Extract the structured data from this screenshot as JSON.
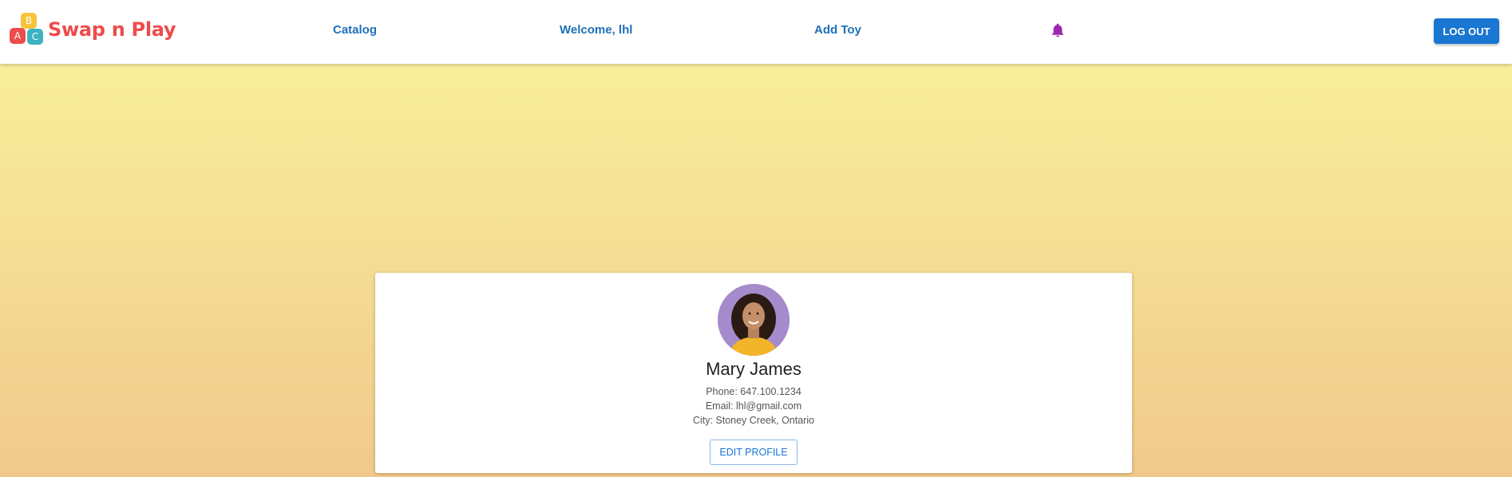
{
  "app": {
    "name": "Swap n Play",
    "logo_letters": [
      "B",
      "A",
      "C"
    ]
  },
  "nav": {
    "catalog": "Catalog",
    "welcome": "Welcome, lhl",
    "add_toy": "Add Toy",
    "notifications_icon": "bell-icon",
    "logout": "LOG OUT"
  },
  "profile": {
    "name": "Mary James",
    "phone": "Phone: 647.100.1234",
    "email": "Email: lhl@gmail.com",
    "city": "City: Stoney Creek, Ontario",
    "edit_label": "EDIT PROFILE"
  },
  "colors": {
    "accent": "#1976d2",
    "nav_link": "#1f6fb8",
    "brand": "#ee4b4b",
    "bell": "#9c27b0"
  }
}
